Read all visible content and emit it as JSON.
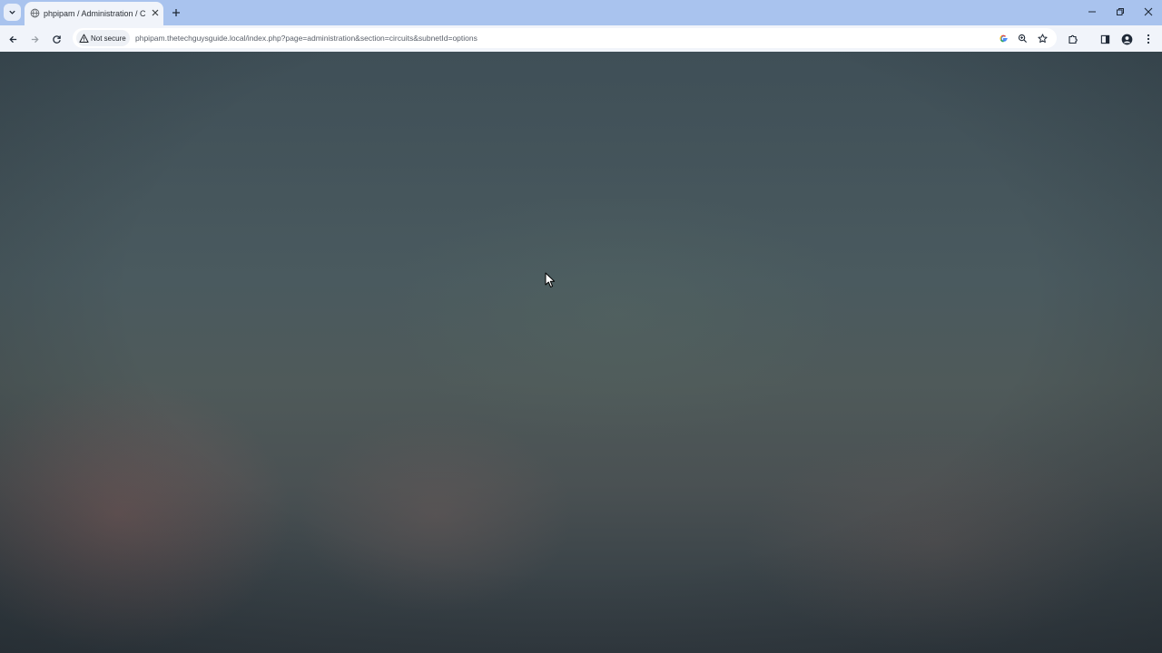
{
  "tab": {
    "title": "phpipam / Administration / Ci",
    "close_icon": "close-icon",
    "favicon": "globe-icon"
  },
  "omnibox": {
    "security_label": "Not secure",
    "url": "phpipam.thetechguysguide.local/index.php?page=administration&section=circuits&subnetId=options"
  },
  "icons": {
    "tab_search": "chevron-down-icon",
    "new_tab": "plus-icon",
    "back": "back-arrow-icon",
    "forward": "forward-arrow-icon",
    "reload": "reload-icon",
    "warning": "warning-icon",
    "google_lens": "google-icon",
    "zoom": "zoom-icon",
    "bookmark": "star-icon",
    "extensions": "puzzle-icon",
    "side_panel": "side-panel-icon",
    "profile": "avatar-icon",
    "menu": "kebab-menu-icon",
    "minimize": "minimize-icon",
    "restore": "restore-icon",
    "window_close": "close-icon"
  },
  "colors": {
    "tabstrip": "#a9c3ee",
    "toolbar": "#f1f4fa",
    "page_background": "#3f4f57"
  }
}
